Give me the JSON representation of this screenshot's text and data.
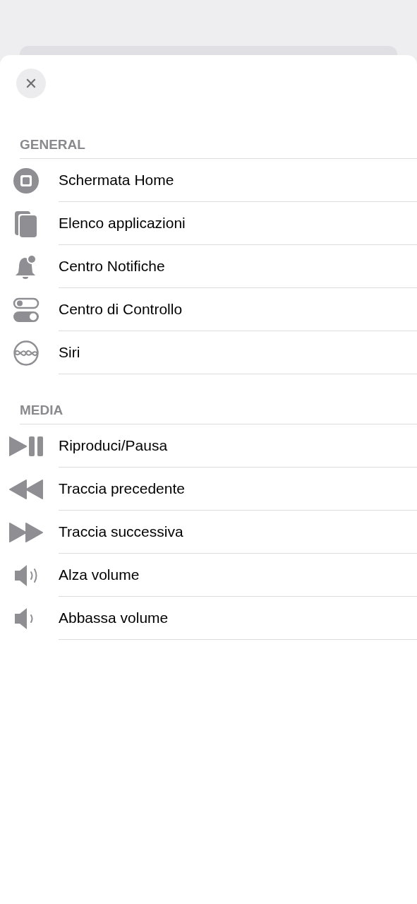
{
  "close_button": {
    "label": "✕"
  },
  "sections": [
    {
      "title": "GENERAL",
      "items": [
        {
          "label": "Schermata Home",
          "kind": "home"
        },
        {
          "label": "Elenco applicazioni",
          "kind": "apps"
        },
        {
          "label": "Centro Notifiche",
          "kind": "bell"
        },
        {
          "label": "Centro di Controllo",
          "kind": "toggles"
        },
        {
          "label": "Siri",
          "kind": "siri"
        }
      ]
    },
    {
      "title": "MEDIA",
      "items": [
        {
          "label": "Riproduci/Pausa",
          "kind": "playpause"
        },
        {
          "label": "Traccia precedente",
          "kind": "rewind"
        },
        {
          "label": "Traccia successiva",
          "kind": "forward"
        },
        {
          "label": "Alza volume",
          "kind": "volup"
        },
        {
          "label": "Abbassa volume",
          "kind": "voldown"
        }
      ]
    }
  ]
}
